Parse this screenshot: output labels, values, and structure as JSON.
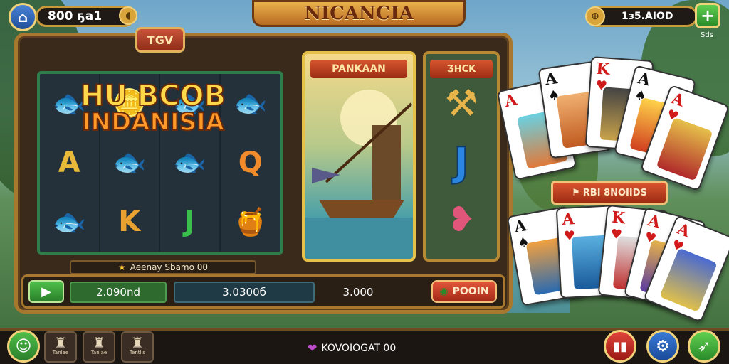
{
  "header": {
    "left_coin_text": "800 ҕа1",
    "title": "NICANCIA",
    "right_balance": "1з5.AIOD",
    "right_sub": "Sds"
  },
  "slot": {
    "badge": "TGV",
    "logo_line1": "HU BCOB",
    "logo_line2": "INDANISIA",
    "jackpot_text": "Aeenay Sbamo 00",
    "reels": [
      [
        "🐟",
        "🪙",
        "🐟",
        "🐟"
      ],
      [
        "A",
        "🐟",
        "🐟",
        "Q"
      ],
      [
        "🐟",
        "K",
        "J",
        "🍯"
      ]
    ],
    "gold_panel_label": "PANKAAN",
    "dark_panel_label": "ƷHCK",
    "dark_panel_symbol": "J"
  },
  "controls": {
    "value1": "2.090nd",
    "value2": "3.0300б",
    "value3": "3.000",
    "spin_label": "POOIN"
  },
  "cards": {
    "banner_text": "RBI 8NOIIDS"
  },
  "footer": {
    "center_text": "KOVOIOGAT 00",
    "nav": [
      {
        "label": "",
        "icon": "home-icon"
      },
      {
        "label": "Tanlae",
        "icon": "chef-icon"
      },
      {
        "label": "Tanlae",
        "icon": "chef-icon"
      },
      {
        "label": "Tentlis",
        "icon": "chef-icon"
      }
    ]
  },
  "colors": {
    "gold": "#c99a3b",
    "red": "#d11a1a",
    "green": "#2a7f2a"
  }
}
